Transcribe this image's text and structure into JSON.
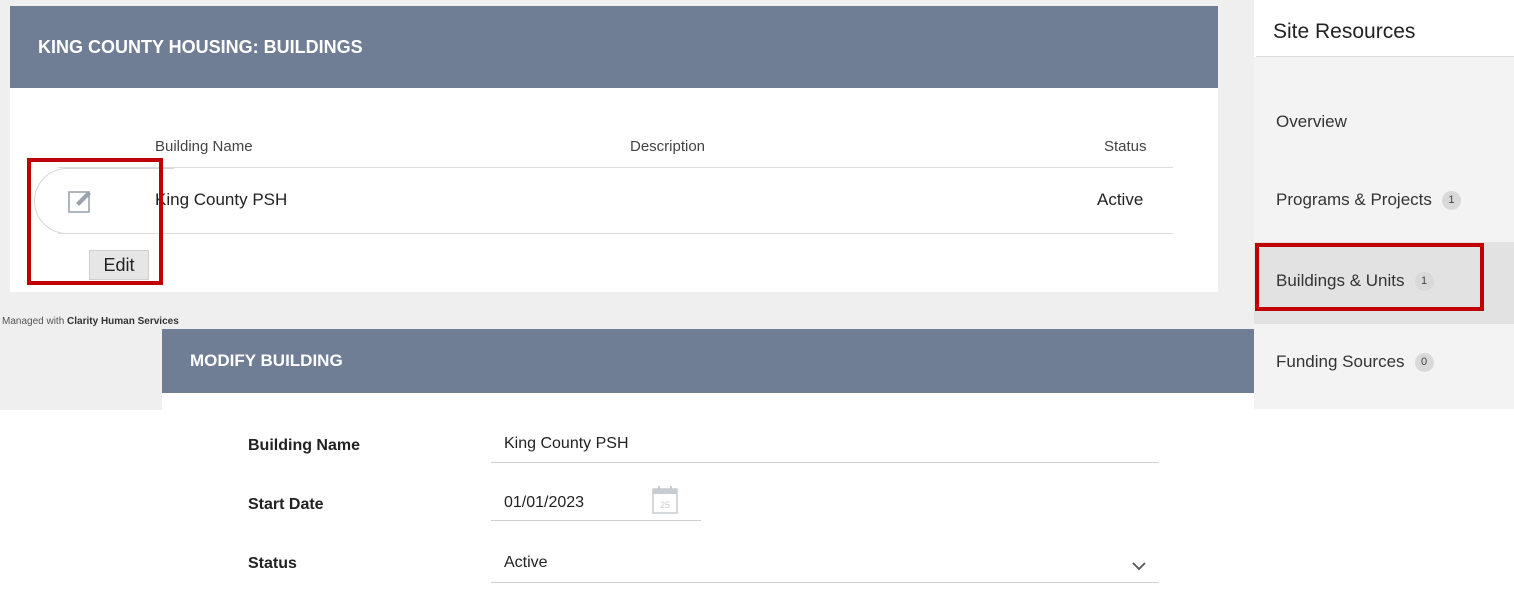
{
  "buildings": {
    "title": "KING COUNTY HOUSING: BUILDINGS",
    "columns": {
      "name": "Building Name",
      "description": "Description",
      "status": "Status"
    },
    "rows": [
      {
        "name": "King County PSH",
        "description": "",
        "status": "Active"
      }
    ],
    "edit_tooltip": "Edit"
  },
  "footer": {
    "prefix": "Managed with",
    "brand": "Clarity Human Services"
  },
  "modify": {
    "title": "MODIFY BUILDING",
    "fields": {
      "building_name": {
        "label": "Building Name",
        "value": "King County PSH"
      },
      "start_date": {
        "label": "Start Date",
        "value": "01/01/2023",
        "calendar_day": "25"
      },
      "status": {
        "label": "Status",
        "value": "Active"
      }
    }
  },
  "sidebar": {
    "title": "Site Resources",
    "items": [
      {
        "label": "Overview"
      },
      {
        "label": "Programs & Projects",
        "badge": "1"
      },
      {
        "label": "Buildings & Units",
        "badge": "1",
        "active": true
      },
      {
        "label": "Funding Sources",
        "badge": "0"
      }
    ]
  },
  "colors": {
    "header": "#6f7d95",
    "highlight": "#c00000"
  },
  "icons": {
    "edit": "edit-icon",
    "calendar": "calendar-icon",
    "dropdown": "chevron-down-icon"
  }
}
